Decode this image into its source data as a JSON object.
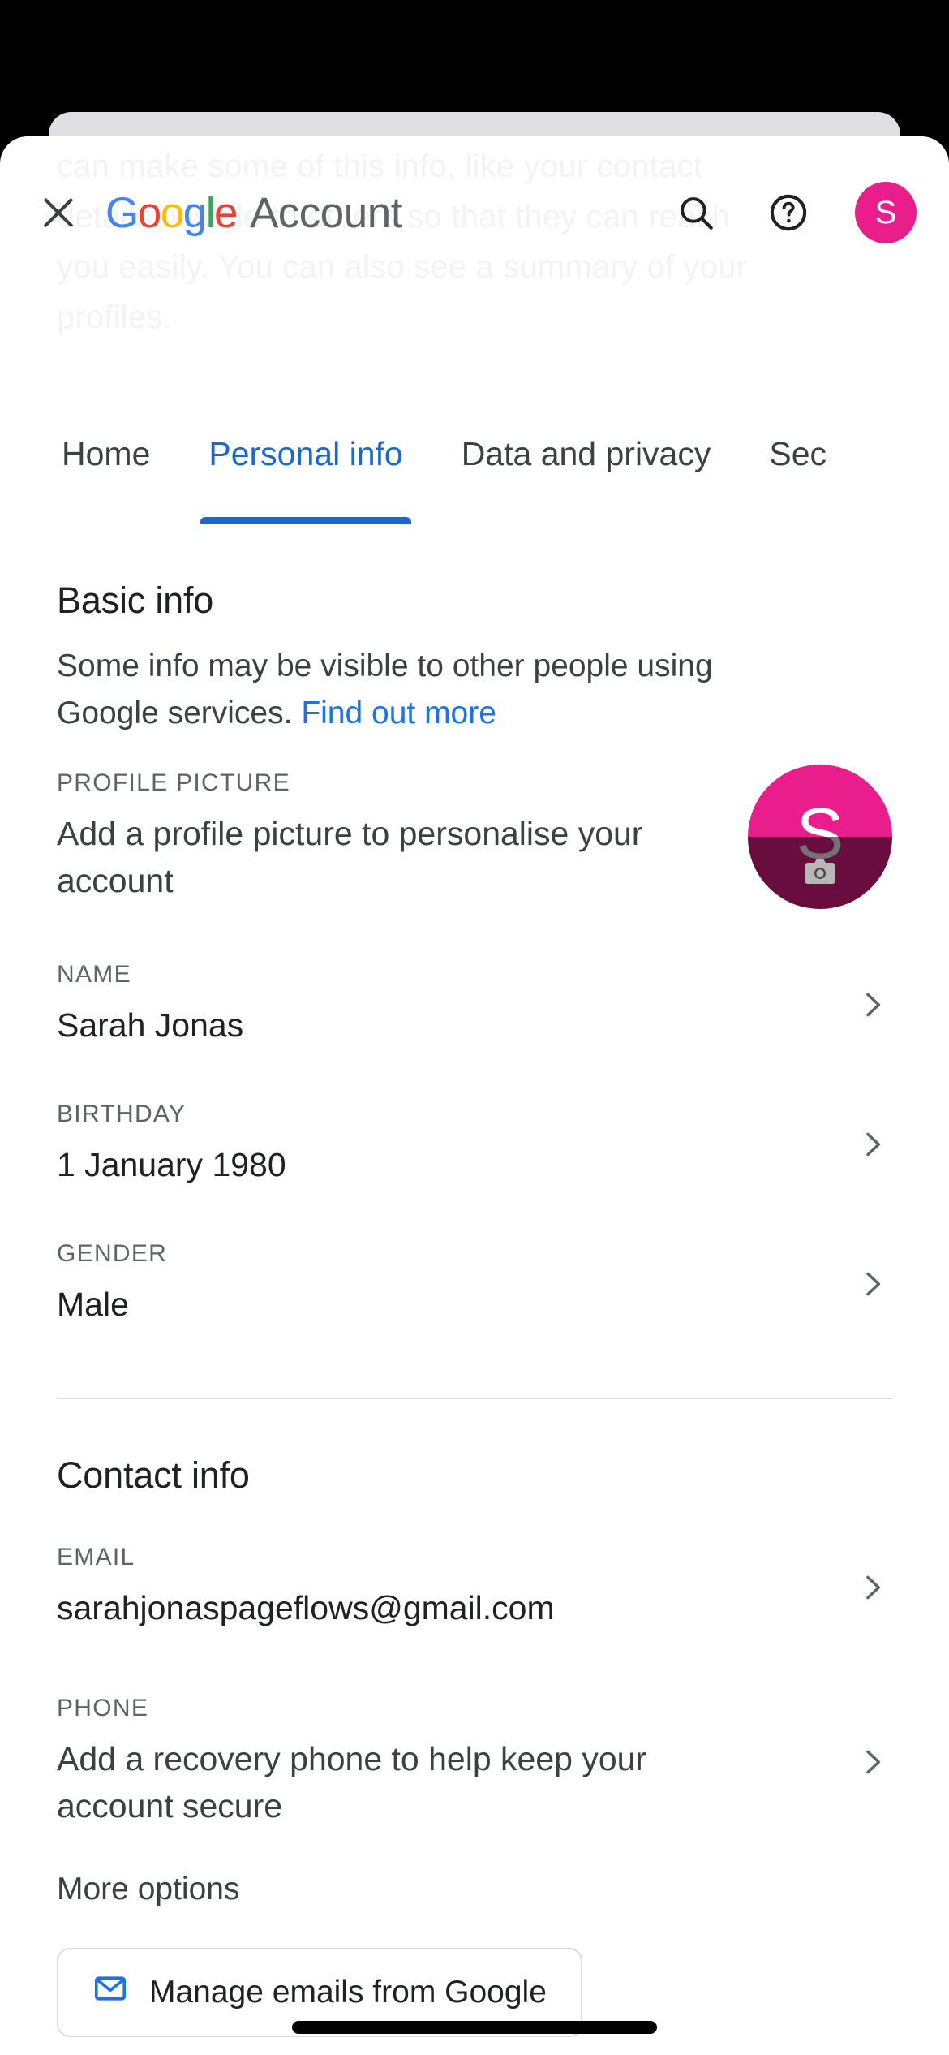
{
  "appbar": {
    "close_label": "close-icon",
    "logo_letters": [
      "G",
      "o",
      "o",
      "g",
      "l",
      "e"
    ],
    "brand_word": "Account",
    "search_label": "Search",
    "help_label": "Help",
    "avatar_initial": "S",
    "accent_blue": "#4285F4",
    "accent_red": "#EA4335",
    "accent_yellow": "#FBBC05",
    "accent_green": "#34A853",
    "avatar_color": "#E91E8C"
  },
  "ghost_text": {
    "line1": "can make some of this info, like your contact",
    "line2": "details, visible to others so that they can reach",
    "line3": "you easily. You can also see a summary of your",
    "line4": "profiles."
  },
  "tabs": [
    {
      "label": "Home",
      "active": false
    },
    {
      "label": "Personal info",
      "active": true
    },
    {
      "label": "Data and privacy",
      "active": false
    },
    {
      "label": "Sec",
      "active": false
    }
  ],
  "basic_info": {
    "title": "Basic info",
    "description": "Some info may be visible to other people using Google services.",
    "link_label": "Find out more",
    "rows": [
      {
        "label": "PROFILE PICTURE",
        "value": "Add a profile picture to personalise your account",
        "avatar_initial": "S"
      },
      {
        "label": "NAME",
        "value": "Sarah Jonas"
      },
      {
        "label": "BIRTHDAY",
        "value": "1 January 1980"
      },
      {
        "label": "GENDER",
        "value": "Male"
      }
    ]
  },
  "contact_info": {
    "title": "Contact info",
    "rows": [
      {
        "label": "EMAIL",
        "value": "sarahjonaspageflows@gmail.com"
      },
      {
        "label": "PHONE",
        "value": "Add a recovery phone to help keep your account secure"
      }
    ],
    "more_options": "More options",
    "manage_button": "Manage emails from Google",
    "manage_button_icon_color": "#1a73e8"
  }
}
